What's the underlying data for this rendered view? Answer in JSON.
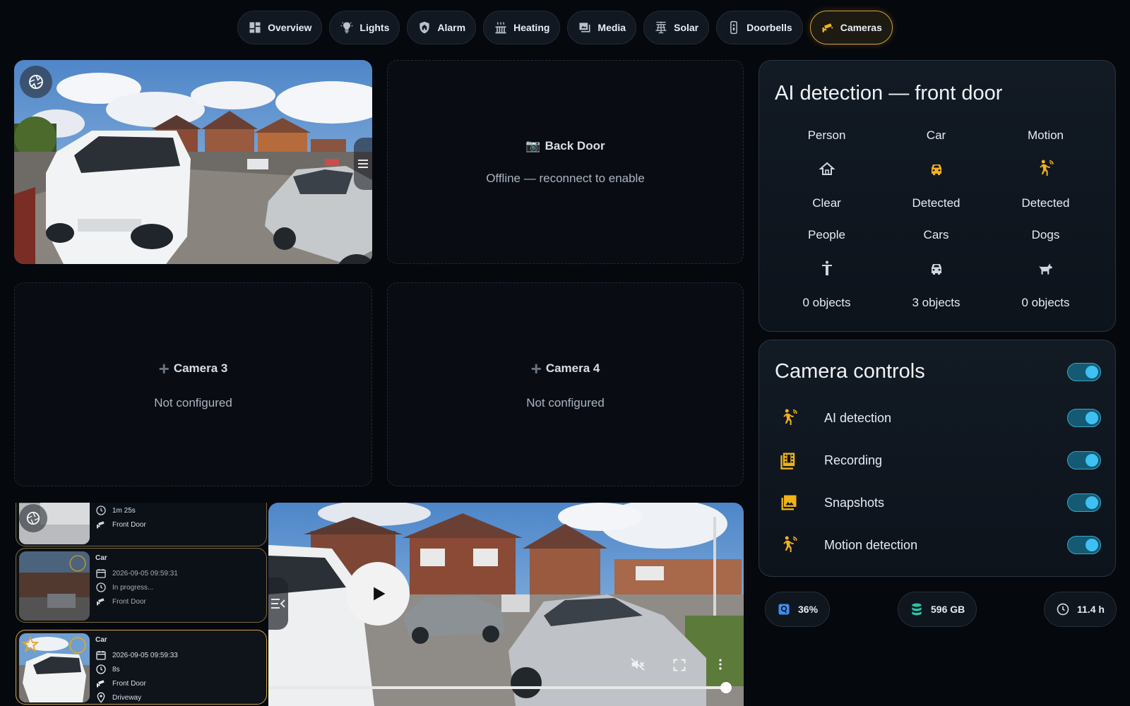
{
  "nav": {
    "tabs": [
      {
        "label": "Overview",
        "icon": "dashboard-icon"
      },
      {
        "label": "Lights",
        "icon": "bulb-icon"
      },
      {
        "label": "Alarm",
        "icon": "shield-home-icon"
      },
      {
        "label": "Heating",
        "icon": "radiator-icon"
      },
      {
        "label": "Media",
        "icon": "media-icon"
      },
      {
        "label": "Solar",
        "icon": "solar-panel-icon"
      },
      {
        "label": "Doorbells",
        "icon": "doorbell-icon"
      },
      {
        "label": "Cameras",
        "icon": "cctv-icon",
        "active": true
      }
    ]
  },
  "cameras": {
    "back_door": {
      "title": "Back Door",
      "emoji": "📷",
      "status": "Offline — reconnect to enable"
    },
    "camera3": {
      "title": "Camera 3",
      "status": "Not configured"
    },
    "camera4": {
      "title": "Camera 4",
      "status": "Not configured"
    }
  },
  "ai_detection": {
    "title": "AI detection — front door",
    "items": [
      {
        "label": "Person",
        "state": "Clear",
        "icon": "home-outline-icon",
        "color": "#cfd6df"
      },
      {
        "label": "Car",
        "state": "Detected",
        "icon": "car-icon",
        "color": "#f1b21a"
      },
      {
        "label": "Motion",
        "state": "Detected",
        "icon": "motion-sensor-icon",
        "color": "#f1b21a"
      },
      {
        "label": "People",
        "state": "0 objects",
        "icon": "human-icon",
        "color": "#cfd6df"
      },
      {
        "label": "Cars",
        "state": "3 objects",
        "icon": "car-outline-icon",
        "color": "#cfd6df"
      },
      {
        "label": "Dogs",
        "state": "0 objects",
        "icon": "dog-icon",
        "color": "#cfd6df"
      }
    ]
  },
  "controls": {
    "title": "Camera controls",
    "items": [
      {
        "label": "AI detection",
        "icon": "motion-sensor-icon",
        "on": true
      },
      {
        "label": "Recording",
        "icon": "filmstrip-icon",
        "on": true
      },
      {
        "label": "Snapshots",
        "icon": "image-multiple-icon",
        "on": true
      },
      {
        "label": "Motion detection",
        "icon": "motion-sensor-icon",
        "on": true
      }
    ]
  },
  "stats": [
    {
      "value": "36%",
      "icon": "cpu-badge-icon",
      "color": "#3b8ff2"
    },
    {
      "value": "596 GB",
      "icon": "database-icon",
      "color": "#2ec4a6"
    },
    {
      "value": "11.4 h",
      "icon": "clock-outline-icon",
      "color": "#cfd6df"
    }
  ],
  "events": [
    {
      "type": "",
      "datetime": "",
      "duration": "1m 25s",
      "camera": "Front Door",
      "zone": ""
    },
    {
      "type": "Car",
      "datetime": "2026-09-05 09:59:31",
      "duration": "In progress...",
      "camera": "Front Door",
      "zone": ""
    },
    {
      "type": "Car",
      "datetime": "2026-09-05 09:59:33",
      "duration": "8s",
      "camera": "Front Door",
      "zone": "Driveway"
    }
  ],
  "colors": {
    "accent": "#d6a034",
    "toggle": "#3ec1f2",
    "detected": "#f1b21a"
  }
}
